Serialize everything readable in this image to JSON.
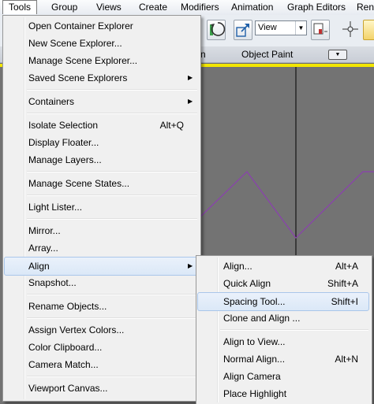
{
  "menubar": {
    "items": [
      "Tools",
      "Group",
      "Views",
      "Create",
      "Modifiers",
      "Animation",
      "Graph Editors",
      "Ren"
    ]
  },
  "toolbar": {
    "view_select": "View"
  },
  "ribbon": {
    "left_label": "n",
    "object_paint": "Object Paint"
  },
  "tools_menu": [
    {
      "label": "Open Container Explorer",
      "shortcut": "",
      "submenu": false
    },
    {
      "label": "New Scene Explorer...",
      "shortcut": "",
      "submenu": false
    },
    {
      "label": "Manage Scene Explorer...",
      "shortcut": "",
      "submenu": false
    },
    {
      "label": "Saved Scene Explorers",
      "shortcut": "",
      "submenu": true
    },
    {
      "label": "Containers",
      "shortcut": "",
      "submenu": true
    },
    {
      "label": "Isolate Selection",
      "shortcut": "Alt+Q",
      "submenu": false
    },
    {
      "label": "Display Floater...",
      "shortcut": "",
      "submenu": false
    },
    {
      "label": "Manage Layers...",
      "shortcut": "",
      "submenu": false
    },
    {
      "label": "Manage Scene States...",
      "shortcut": "",
      "submenu": false
    },
    {
      "label": "Light Lister...",
      "shortcut": "",
      "submenu": false
    },
    {
      "label": "Mirror...",
      "shortcut": "",
      "submenu": false
    },
    {
      "label": "Array...",
      "shortcut": "",
      "submenu": false
    },
    {
      "label": "Align",
      "shortcut": "",
      "submenu": true,
      "active": true
    },
    {
      "label": "Snapshot...",
      "shortcut": "",
      "submenu": false
    },
    {
      "label": "Rename Objects...",
      "shortcut": "",
      "submenu": false
    },
    {
      "label": "Assign Vertex Colors...",
      "shortcut": "",
      "submenu": false
    },
    {
      "label": "Color Clipboard...",
      "shortcut": "",
      "submenu": false
    },
    {
      "label": "Camera Match...",
      "shortcut": "",
      "submenu": false
    },
    {
      "label": "Viewport Canvas...",
      "shortcut": "",
      "submenu": false
    }
  ],
  "align_menu": [
    {
      "label": "Align...",
      "shortcut": "Alt+A"
    },
    {
      "label": "Quick Align",
      "shortcut": "Shift+A"
    },
    {
      "label": "Spacing Tool...",
      "shortcut": "Shift+I",
      "hover": true
    },
    {
      "label": "Clone and Align ...",
      "shortcut": ""
    },
    {
      "label": "Align to View...",
      "shortcut": ""
    },
    {
      "label": "Normal Align...",
      "shortcut": "Alt+N"
    },
    {
      "label": "Align Camera",
      "shortcut": ""
    },
    {
      "label": "Place Highlight",
      "shortcut": ""
    }
  ],
  "colors": {
    "viewport_bg": "#737373",
    "viewport_highlight": "#f2e600",
    "curve": "#8b3fb0"
  }
}
